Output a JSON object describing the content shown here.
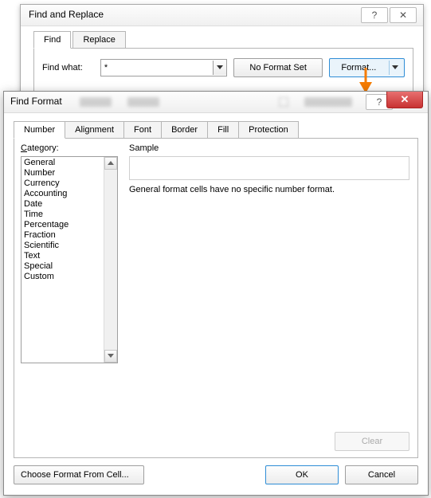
{
  "findReplace": {
    "title": "Find and Replace",
    "tabs": [
      "Find",
      "Replace"
    ],
    "findWhatLabel": "Find what:",
    "findWhatValue": "*",
    "noFormatSet": "No Format Set",
    "formatLabel": "Format..."
  },
  "findFormat": {
    "title": "Find Format",
    "tabs": [
      "Number",
      "Alignment",
      "Font",
      "Border",
      "Fill",
      "Protection"
    ],
    "categoryLabel": "Category:",
    "categories": [
      "General",
      "Number",
      "Currency",
      "Accounting",
      "Date",
      "Time",
      "Percentage",
      "Fraction",
      "Scientific",
      "Text",
      "Special",
      "Custom"
    ],
    "sampleLabel": "Sample",
    "message": "General format cells have no specific number format.",
    "clearLabel": "Clear",
    "chooseFromCell": "Choose Format From Cell...",
    "okLabel": "OK",
    "cancelLabel": "Cancel"
  }
}
